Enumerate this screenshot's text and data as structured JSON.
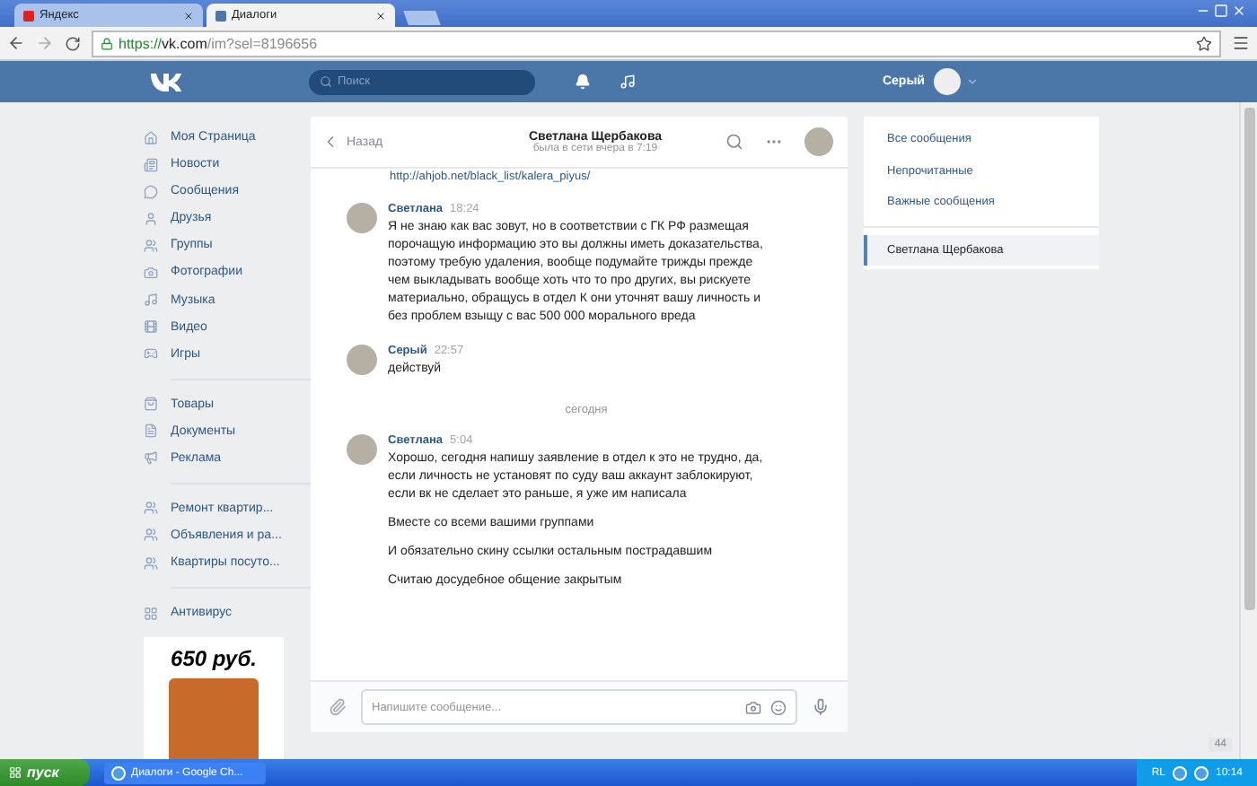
{
  "browser": {
    "tabs": [
      {
        "title": "Яндекс",
        "selected": false
      },
      {
        "title": "Диалоги",
        "selected": true
      }
    ],
    "url": {
      "scheme": "https://",
      "host": "vk.com",
      "path": "/im?sel=8196656"
    }
  },
  "header": {
    "search_placeholder": "Поиск",
    "user_name": "Серый"
  },
  "left_nav": {
    "groups": [
      {
        "items": [
          "Моя Страница",
          "Новости",
          "Сообщения",
          "Друзья",
          "Группы",
          "Фотографии",
          "Музыка",
          "Видео",
          "Игры"
        ]
      },
      {
        "items": [
          "Товары",
          "Документы",
          "Реклама"
        ]
      },
      {
        "items": [
          "Ремонт квартир...",
          "Объявления и ра...",
          "Квартиры посуто..."
        ]
      },
      {
        "items": [
          "Антивирус"
        ]
      }
    ]
  },
  "ad": {
    "price": "650 руб."
  },
  "chat": {
    "back": "Назад",
    "name": "Светлана Щербакова",
    "status": "была в сети вчера в 7:19",
    "feed": [
      {
        "kind": "link",
        "text": "http://ahjob.net/black_list/kalera_piyus/"
      },
      {
        "kind": "message",
        "author": "Светлана",
        "time": "18:24",
        "paragraphs": [
          "Я не знаю как вас зовут, но в соответствии с ГК РФ размещая порочащую информацию это вы должны иметь доказательства, поэтому требую удаления, вообще подумайте трижды прежде чем выкладывать вообще хоть что то про других, вы рискуете материально, обращусь в отдел К они уточнят вашу личность и без проблем взыщу с вас 500 000 морального вреда"
        ]
      },
      {
        "kind": "message",
        "author": "Серый",
        "time": "22:57",
        "paragraphs": [
          "действуй"
        ]
      },
      {
        "kind": "date",
        "text": "сегодня"
      },
      {
        "kind": "message",
        "author": "Светлана",
        "time": "5:04",
        "paragraphs": [
          "Хорошо, сегодня напишу заявление в отдел к это не трудно, да, если личность не установят по суду ваш аккаунт заблокируют, если вк не сделает это раньше, я уже им написала",
          "Вместе со всеми вашими группами",
          "И обязательно скину ссылки остальным пострадавшим",
          "Считаю досудебное общение закрытым"
        ]
      }
    ],
    "composer_placeholder": "Напишите сообщение..."
  },
  "right_menu": [
    {
      "label": "Все сообщения",
      "selected": false
    },
    {
      "label": "Непрочитанные",
      "selected": false
    },
    {
      "label": "Важные сообщения",
      "selected": false
    },
    {
      "label": "Светлана Щербакова",
      "selected": true
    }
  ],
  "corner_counter": "44",
  "taskbar": {
    "start": "пуск",
    "task": "Диалоги - Google Ch...",
    "lang": "RL",
    "clock": "10:14"
  }
}
